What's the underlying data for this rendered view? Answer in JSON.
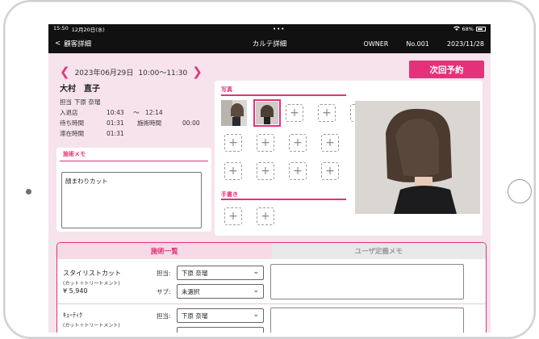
{
  "status_bar": {
    "time": "15:50",
    "date": "12月20日(水)",
    "dots": "•••",
    "battery": "68%"
  },
  "nav": {
    "back_label": "顧客詳細",
    "title": "カルテ詳細",
    "role": "OWNER",
    "number": "No.001",
    "date": "2023/11/28"
  },
  "visit": {
    "date": "2023年06月29日",
    "time_range": "10:00～11:30"
  },
  "next_button": "次回予約",
  "customer": {
    "name": "大村　直子",
    "staff_label": "担当",
    "staff": "下原 奈瑠",
    "entry_label": "入退店",
    "entry_time": "10:43",
    "tilde": "～",
    "exit_time": "12:14",
    "wait_label": "待ち時間",
    "wait_time": "01:31",
    "treat_label": "施術時間",
    "treat_time": "00:00",
    "stay_label": "滞在時間",
    "stay_time": "01:31"
  },
  "memo": {
    "header": "施術メモ",
    "text": "顔まわりカット"
  },
  "photos": {
    "header": "写真",
    "handwriting_header": "手書き",
    "plus_glyph": "+"
  },
  "tabs": {
    "services": "施術一覧",
    "user_memo": "ユーザ定義メモ"
  },
  "services": [
    {
      "name": "スタイリストカット",
      "sub": "(カット＋トリートメント)",
      "price": "¥ 5,940",
      "staff_label": "担当:",
      "staff": "下原 奈瑠",
      "sub_label": "サブ:",
      "sub_staff": "未選択"
    },
    {
      "name": "ｷｭｰﾃｨｸ",
      "sub": "(カット＋トリートメント)",
      "price": "",
      "staff_label": "担当:",
      "staff": "下原 奈瑠",
      "sub_label": "",
      "sub_staff": ""
    }
  ],
  "colors": {
    "accent": "#e4317a",
    "bg": "#f6e3ec",
    "bar": "#111111"
  }
}
